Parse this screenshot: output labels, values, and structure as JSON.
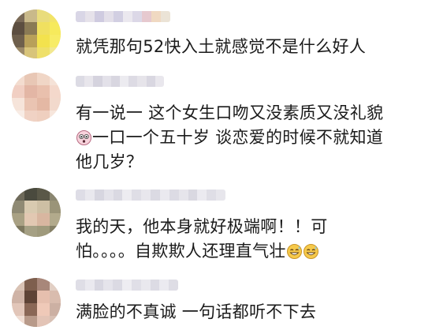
{
  "comments": [
    {
      "lines": [
        "就凭那句52快入土就感觉不是什么好人"
      ]
    },
    {
      "lines": [
        "有一说一 这个女生口吻又没素质又没礼貌",
        "一口一个五十岁 谈恋爱的时候不就知道",
        "他几岁？"
      ],
      "emoji": "shocked-face-emoji"
    },
    {
      "lines": [
        "我的天，他本身就好极端啊！！可",
        "怕。。。。自欺欺人还理直气壮"
      ],
      "emoji": "sweat-grin-emoji"
    },
    {
      "lines": [
        "满脸的不真诚 一句话都听不下去"
      ]
    }
  ],
  "colors": {
    "text": "#1b1b1b",
    "background": "#ffffff"
  }
}
